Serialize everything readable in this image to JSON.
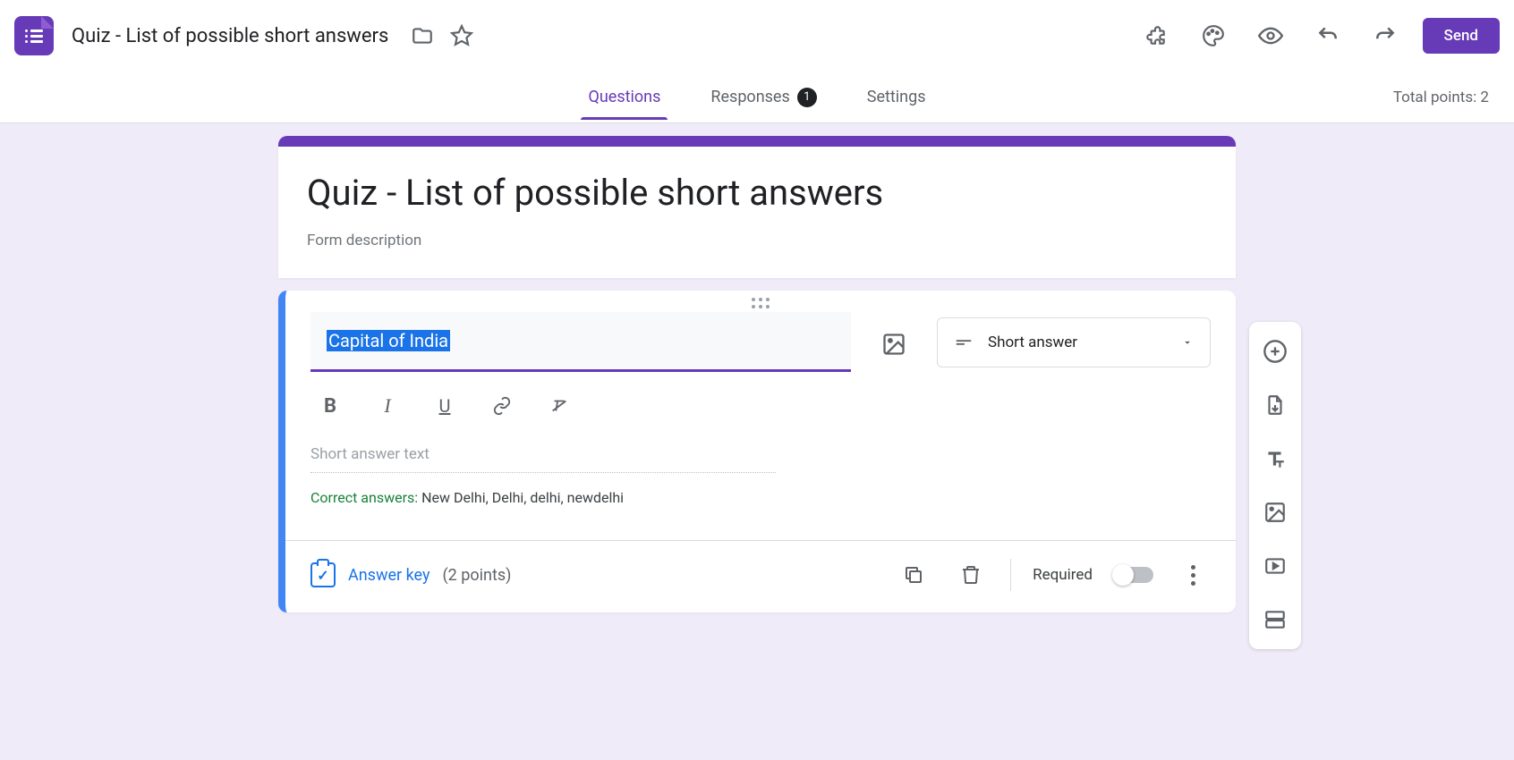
{
  "header": {
    "title": "Quiz - List of possible short answers",
    "send_label": "Send"
  },
  "tabs": {
    "questions": "Questions",
    "responses": "Responses",
    "responses_count": "1",
    "settings": "Settings",
    "total_points": "Total points: 2"
  },
  "form": {
    "title": "Quiz - List of possible short answers",
    "description_placeholder": "Form description"
  },
  "question": {
    "text": "Capital of India",
    "type_label": "Short answer",
    "answer_placeholder": "Short answer text",
    "correct_label": "Correct answers: ",
    "correct_values": "New Delhi, Delhi, delhi, newdelhi",
    "answer_key_label": "Answer key",
    "points_label": "(2 points)",
    "required_label": "Required"
  }
}
